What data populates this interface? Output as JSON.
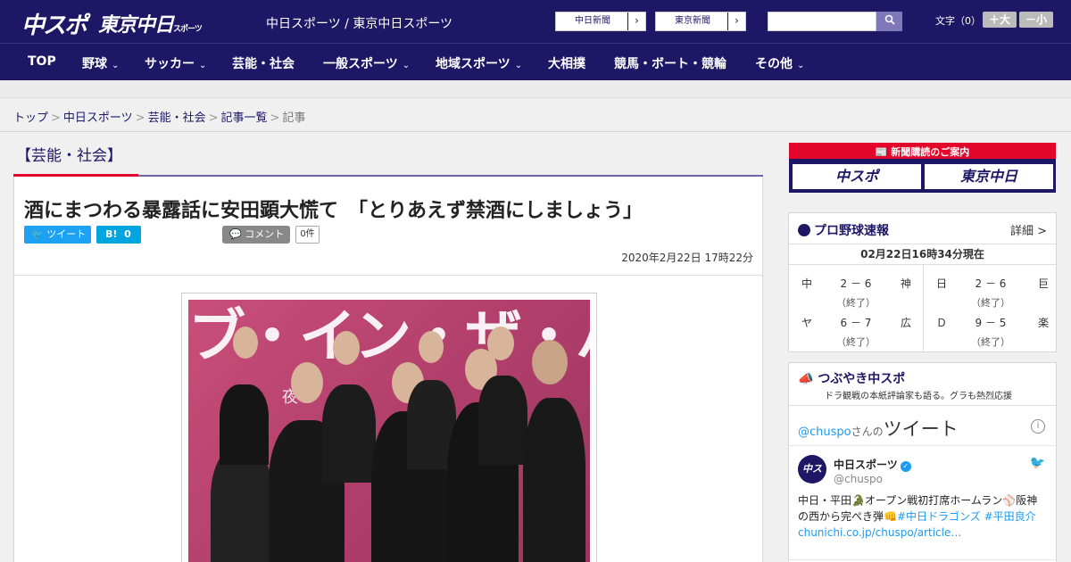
{
  "header": {
    "logo_chuspo": "中スポ",
    "logo_tokyo": "東京中日",
    "logo_tokyo_small": "スポーツ",
    "site_names": "中日スポーツ / 東京中日スポーツ",
    "chunichi_btn": "中日新聞",
    "tokyo_btn": "東京新聞",
    "arrow": "›",
    "search_placeholder": "",
    "search_icon": "search-icon",
    "font_size_label": "文字（0）",
    "font_large": "＋大",
    "font_small": "－小"
  },
  "nav": {
    "items": [
      {
        "label": "TOP",
        "has_menu": false
      },
      {
        "label": "野球",
        "has_menu": true
      },
      {
        "label": "サッカー",
        "has_menu": true
      },
      {
        "label": "芸能・社会",
        "has_menu": false
      },
      {
        "label": "一般スポーツ",
        "has_menu": true
      },
      {
        "label": "地域スポーツ",
        "has_menu": true
      },
      {
        "label": "大相撲",
        "has_menu": false
      },
      {
        "label": "競馬・ボート・競輪",
        "has_menu": false
      },
      {
        "label": "その他",
        "has_menu": true
      }
    ],
    "chevron": "⌄"
  },
  "breadcrumb": {
    "items": [
      "トップ",
      "中日スポーツ",
      "芸能・社会",
      "記事一覧"
    ],
    "current": "記事",
    "sep": ">"
  },
  "article": {
    "category": "【芸能・社会】",
    "headline": "酒にまつわる暴露話に安田顕大慌て　「とりあえず禁酒にしましょう」",
    "tweet_btn": "ツイート",
    "hatena_btn": "B!",
    "hatena_count": "0",
    "comment_btn": "コメント",
    "comment_count": "0件",
    "date": "2020年2月22日 17時22分",
    "photo_text": "ブ・イン・ザ・バン",
    "photo_subtext": "夜　　パ"
  },
  "sidebar": {
    "subscribe_title": "新聞購読のご案内",
    "subscribe_chuspo": "中スポ",
    "subscribe_tokyo": "東京中日",
    "baseball": {
      "title": "プロ野球速報",
      "detail": "詳細 >",
      "updated": "02月22日16時34分現在",
      "games": [
        {
          "home": "中",
          "score": "2 － 6",
          "away": "神",
          "status": "（終了）"
        },
        {
          "home": "日",
          "score": "2 － 6",
          "away": "巨",
          "status": "（終了）"
        },
        {
          "home": "ヤ",
          "score": "6 － 7",
          "away": "広",
          "status": "（終了）"
        },
        {
          "home": "Ｄ",
          "score": "9 － 5",
          "away": "楽",
          "status": "（終了）"
        }
      ]
    },
    "tweets": {
      "title": "つぶやき中スポ",
      "subtitle": "ドラ観戦の本紙評論家も語る。グラも熱烈応援",
      "handle_link": "@chuspo",
      "handle_suffix": "さんの",
      "heading": "ツイート",
      "info": "i",
      "account_name": "中日スポーツ",
      "account_handle": "@chuspo",
      "avatar_text": "中スポ",
      "verified": "✓",
      "bird": "🐦",
      "body_1": "中日・平田🐊オープン戦初打席ホームラン⚾阪神の西から完ぺき弾👊",
      "body_tags": "#中日ドラゴンズ #平田良介",
      "body_link": "chunichi.co.jp/chuspo/article…"
    }
  }
}
